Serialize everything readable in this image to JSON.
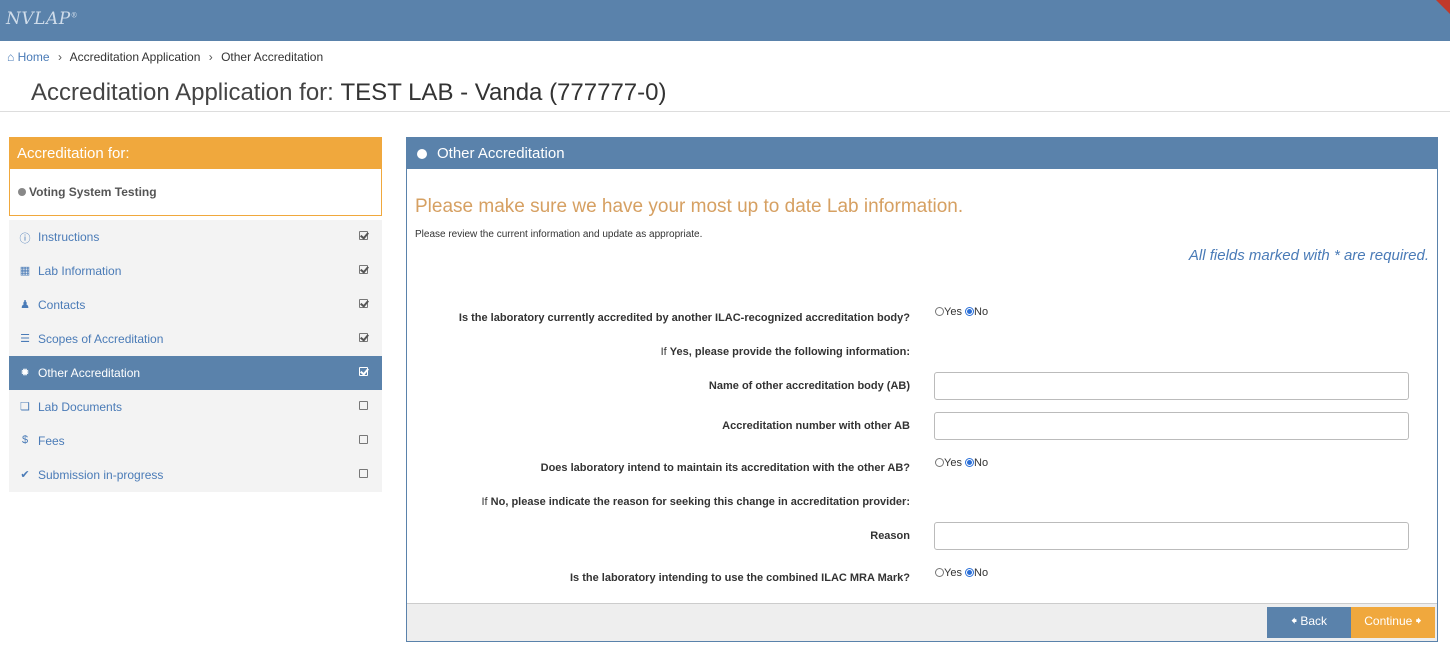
{
  "header": {
    "logo_text": "NVLAP",
    "logo_mark": "®"
  },
  "breadcrumb": {
    "home": "Home",
    "items": [
      "Accreditation Application",
      "Other Accreditation"
    ]
  },
  "page": {
    "title_prefix": "Accreditation Application for:",
    "lab_name": "TEST LAB - Vanda (777777-0)"
  },
  "sidebar": {
    "accreditation_header": "Accreditation for:",
    "program": "Voting System Testing",
    "items": [
      {
        "label": "Instructions",
        "icon": "info-icon",
        "complete": true,
        "active": false
      },
      {
        "label": "Lab Information",
        "icon": "building-icon",
        "complete": true,
        "active": false
      },
      {
        "label": "Contacts",
        "icon": "user-icon",
        "complete": true,
        "active": false
      },
      {
        "label": "Scopes of Accreditation",
        "icon": "list-icon",
        "complete": true,
        "active": false
      },
      {
        "label": "Other Accreditation",
        "icon": "certificate-icon",
        "complete": true,
        "active": true
      },
      {
        "label": "Lab Documents",
        "icon": "documents-icon",
        "complete": false,
        "active": false
      },
      {
        "label": "Fees",
        "icon": "dollar-icon",
        "complete": false,
        "active": false
      },
      {
        "label": "Submission in-progress",
        "icon": "check-icon",
        "complete": false,
        "active": false
      }
    ]
  },
  "panel": {
    "title": "Other Accreditation",
    "intro_title": "Please make sure we have your most up to date Lab information.",
    "intro_sub": "Please review the current information and update as appropriate.",
    "required_note": "All fields marked with * are required."
  },
  "form": {
    "q1": {
      "label": "Is the laboratory currently accredited by another ILAC-recognized accreditation body?",
      "value": "No"
    },
    "if_yes": {
      "prefix": "If ",
      "keyword": "Yes",
      "suffix": ", please provide the following information:"
    },
    "ab_name": {
      "label": "Name of other accreditation body (AB)",
      "value": ""
    },
    "ab_number": {
      "label": "Accreditation number with other AB",
      "value": ""
    },
    "q2": {
      "label": "Does laboratory intend to maintain its accreditation with the other AB?",
      "value": "No"
    },
    "if_no": {
      "prefix": "If ",
      "keyword": "No",
      "suffix": ", please indicate the reason for seeking this change in accreditation provider:"
    },
    "reason": {
      "label": "Reason",
      "value": ""
    },
    "q3": {
      "label": "Is the laboratory intending to use the combined ILAC MRA Mark?",
      "value": "No"
    },
    "yes_label": "Yes",
    "no_label": "No"
  },
  "buttons": {
    "back": "Back",
    "continue": "Continue"
  },
  "colors": {
    "primary": "#5a82ab",
    "accent": "#f0a83d",
    "link": "#4a7bb7"
  }
}
